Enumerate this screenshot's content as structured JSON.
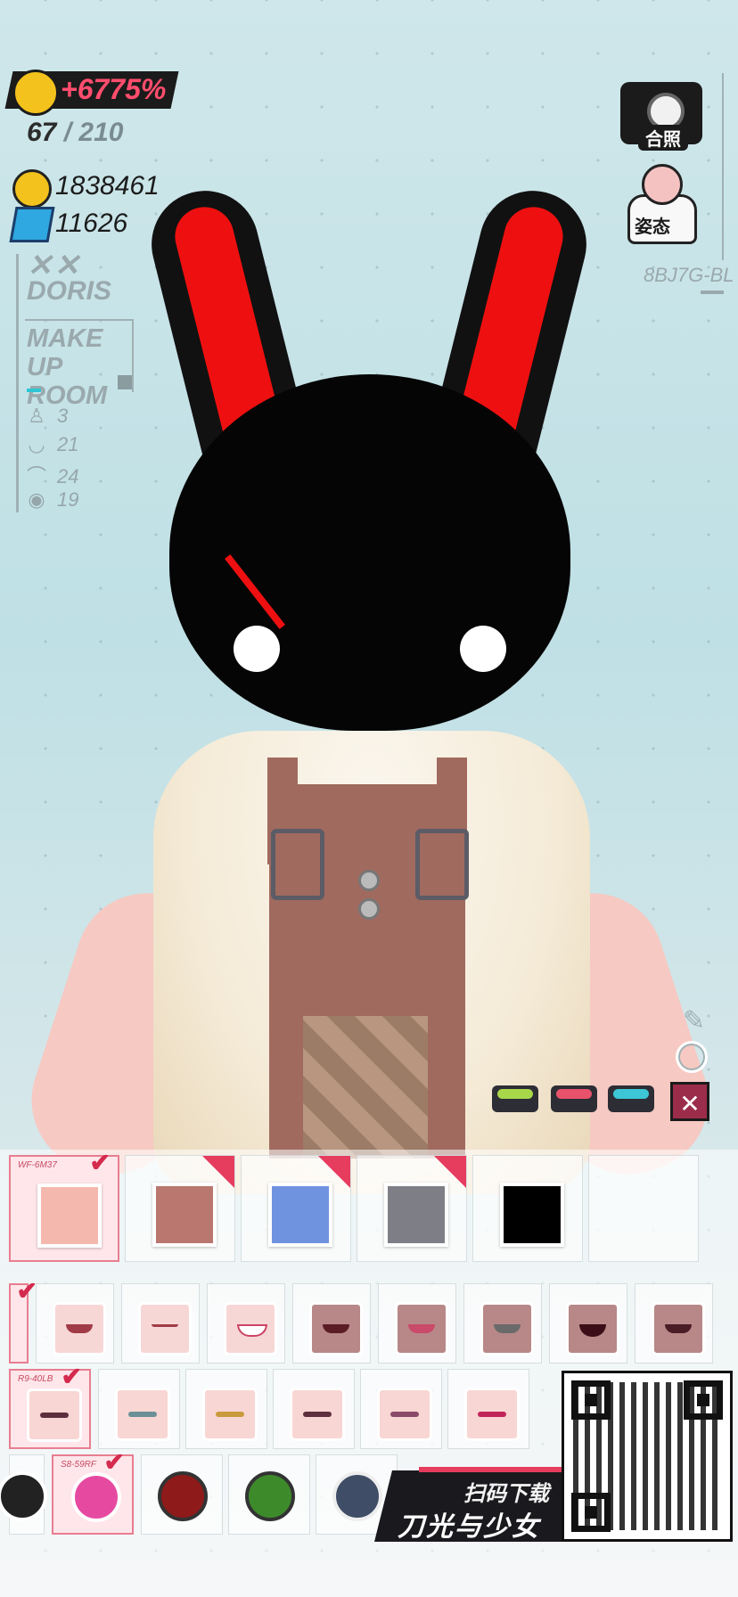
{
  "hud": {
    "boost_text": "+6775%",
    "level_current": "67",
    "level_separator": "/",
    "level_max": "210",
    "coins": "1838461",
    "gems": "11626",
    "crossed_marks": "✕✕",
    "player_name": "DORIS",
    "room_title_line1": "MAKE UP",
    "room_title_line2": "ROOM",
    "stats": [
      {
        "icon": "figure-icon",
        "glyph": "♙",
        "value": "3"
      },
      {
        "icon": "lips-icon",
        "glyph": "◡",
        "value": "21"
      },
      {
        "icon": "eyelash-icon",
        "glyph": "⌒",
        "value": "24"
      },
      {
        "icon": "eye-ring-icon",
        "glyph": "◉",
        "value": "19"
      }
    ],
    "camera_label": "合照",
    "pose_label": "姿态",
    "player_code": "8BJ7G-BL"
  },
  "colors": {
    "accent_pink": "#e63c5e",
    "boost_text": "#ff4d6d",
    "close_button": "#9b2d4b",
    "mask_black": "#050505",
    "mask_red": "#ee1010",
    "swatch_green": "#a8d84a",
    "swatch_red": "#e8526a",
    "swatch_cyan": "#3cc6d6"
  },
  "tools": {
    "close_glyph": "✕",
    "pen_glyph": "✎"
  },
  "panel": {
    "skin_row": {
      "selected_label": "WF-6M37",
      "items": [
        {
          "color": "#f4b8ae",
          "selected": true
        },
        {
          "color": "#b97770",
          "selected": false
        },
        {
          "color": "#6f93df",
          "selected": false
        },
        {
          "color": "#7e7f86",
          "selected": false
        },
        {
          "color": "#000000",
          "selected": false
        }
      ]
    },
    "mouth_row": {
      "items": [
        "mouth-1",
        "mouth-2",
        "mouth-3",
        "mouth-4",
        "mouth-5",
        "mouth-6",
        "mouth-7",
        "mouth-8"
      ]
    },
    "eye_row": {
      "selected_label": "R9-40LB",
      "items": [
        "eye-1",
        "eye-2",
        "eye-3",
        "eye-4",
        "eye-5",
        "eye-6"
      ]
    },
    "pupil_row": {
      "selected_label": "S8-59RF",
      "items": [
        {
          "color": "#222222"
        },
        {
          "color": "#e64aa0",
          "selected": true
        },
        {
          "color": "#8e1a1a"
        },
        {
          "color": "#3d8a2b"
        },
        {
          "color": "#3f4d66"
        }
      ]
    },
    "check_glyph": "✔"
  },
  "promo": {
    "scan_text": "扫码下载",
    "game_title": "刀光与少女"
  }
}
